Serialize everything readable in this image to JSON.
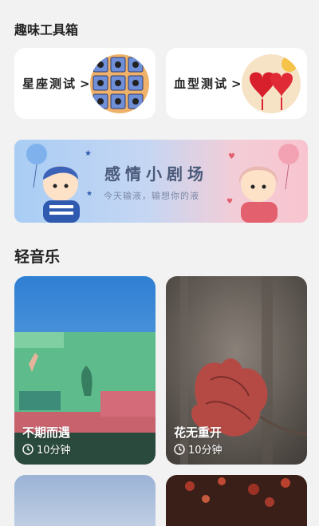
{
  "toolbox": {
    "title": "趣味工具箱",
    "items": [
      {
        "label": "星座测试",
        "arrow": ">",
        "icon": "zodiac-cards-image"
      },
      {
        "label": "血型测试",
        "arrow": ">",
        "icon": "blood-type-hearts-image"
      }
    ]
  },
  "banner": {
    "title": "感情小剧场",
    "subtitle": "今天输液，输想你的液"
  },
  "music": {
    "title": "轻音乐",
    "items": [
      {
        "name": "不期而遇",
        "duration": "10分钟"
      },
      {
        "name": "花无重开",
        "duration": "10分钟"
      }
    ]
  }
}
